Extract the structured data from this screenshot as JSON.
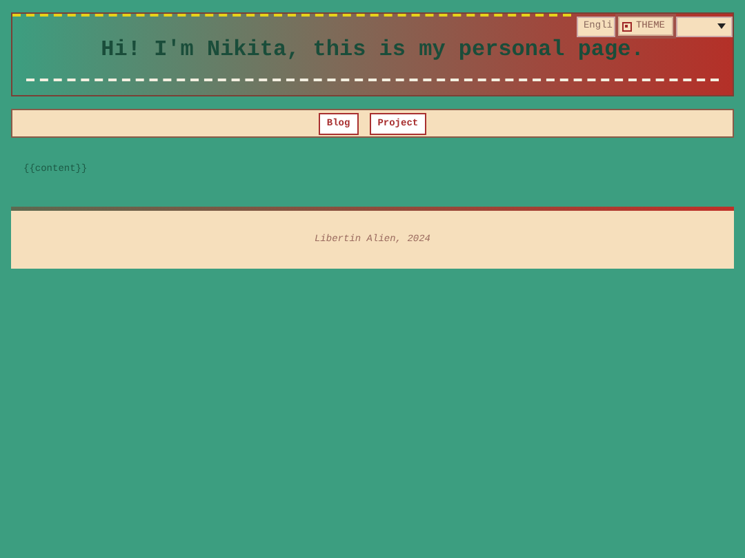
{
  "header": {
    "title": "Hi! I'm Nikita, this is my personal page.",
    "language": "Engli",
    "theme_button": {
      "label": "THEME",
      "checked": true
    }
  },
  "nav": [
    {
      "label": "Blog"
    },
    {
      "label": "Project"
    }
  ],
  "content": "{{content}}",
  "footer": "Libertin Alien, 2024"
}
